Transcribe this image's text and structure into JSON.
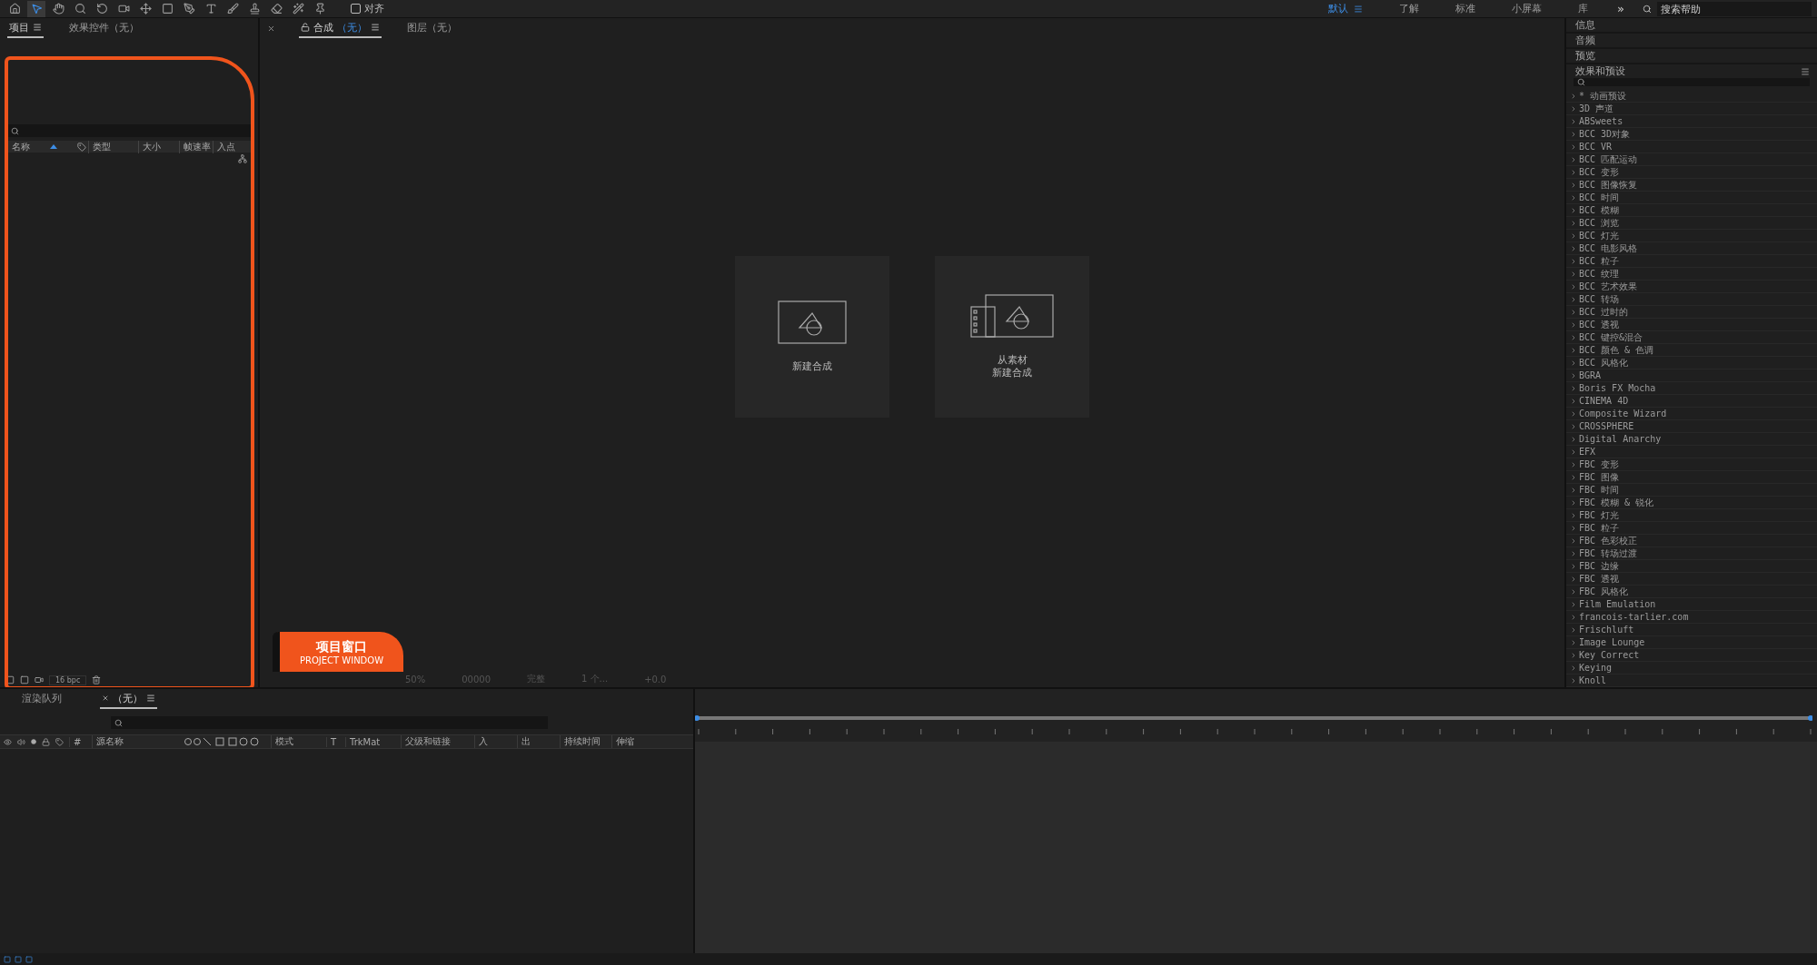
{
  "toolbar": {
    "tools": [
      {
        "kind": "home",
        "selected": false
      },
      {
        "kind": "select",
        "selected": true
      },
      {
        "kind": "hand",
        "selected": false
      },
      {
        "kind": "zoom",
        "selected": false
      },
      {
        "kind": "rotate",
        "selected": false
      },
      {
        "kind": "camera",
        "selected": false
      },
      {
        "kind": "anchor",
        "selected": false
      },
      {
        "kind": "rect",
        "selected": false
      },
      {
        "kind": "pen",
        "selected": false
      },
      {
        "kind": "type",
        "selected": false
      },
      {
        "kind": "brush",
        "selected": false
      },
      {
        "kind": "stamp",
        "selected": false
      },
      {
        "kind": "eraser",
        "selected": false
      },
      {
        "kind": "roto",
        "selected": false
      },
      {
        "kind": "pin",
        "selected": false
      }
    ],
    "snap": {
      "label": "对齐",
      "checked": false
    }
  },
  "workspaces": [
    {
      "label": "默认",
      "selected": true
    },
    {
      "label": "了解",
      "selected": false
    },
    {
      "label": "标准",
      "selected": false
    },
    {
      "label": "小屏幕",
      "selected": false
    },
    {
      "label": "库",
      "selected": false
    }
  ],
  "more": "»",
  "help_search": {
    "placeholder": "搜索帮助"
  },
  "project_panel": {
    "tabs": [
      {
        "label": "项目",
        "selected": true
      },
      {
        "label": "效果控件（无）",
        "selected": false
      }
    ],
    "columns": [
      "名称",
      "类型",
      "大小",
      "帧速率",
      "入点"
    ],
    "bit_depth": "16 bpc"
  },
  "viewer": {
    "tabs": [
      {
        "label": "合成",
        "target": "（无）",
        "selected": true
      },
      {
        "label": "图层（无）",
        "selected": false
      }
    ],
    "actions": [
      {
        "kind": "new",
        "lines": [
          "新建合成"
        ]
      },
      {
        "kind": "from_footage",
        "lines": [
          "从素材",
          "新建合成"
        ]
      }
    ],
    "footer": [
      "50%",
      "00000",
      "完整",
      "1 个...",
      "+0.0"
    ]
  },
  "callout": {
    "title": "项目窗口",
    "subtitle": "PROJECT WINDOW"
  },
  "side_panels": [
    "信息",
    "音频",
    "预览"
  ],
  "effects": {
    "title": "效果和预设",
    "items": [
      "* 动画预设",
      "3D 声道",
      "ABSweets",
      "BCC 3D对象",
      "BCC VR",
      "BCC 匹配运动",
      "BCC 变形",
      "BCC 图像恢复",
      "BCC 时间",
      "BCC 模糊",
      "BCC 浏览",
      "BCC 灯光",
      "BCC 电影风格",
      "BCC 粒子",
      "BCC 纹理",
      "BCC 艺术效果",
      "BCC 转场",
      "BCC 过时的",
      "BCC 透视",
      "BCC 键控&混合",
      "BCC 颜色 & 色调",
      "BCC 风格化",
      "BGRA",
      "Boris FX Mocha",
      "CINEMA 4D",
      "Composite Wizard",
      "CROSSPHERE",
      "Digital Anarchy",
      "EFX",
      "FBC 变形",
      "FBC 图像",
      "FBC 时间",
      "FBC 模糊 & 锐化",
      "FBC 灯光",
      "FBC 粒子",
      "FBC 色彩校正",
      "FBC 转场过渡",
      "FBC 边缘",
      "FBC 透视",
      "FBC 风格化",
      "Film Emulation",
      "francois-tarlier.com",
      "Frischluft",
      "Image Lounge",
      "Key Correct",
      "Keying",
      "Knoll"
    ]
  },
  "timeline": {
    "tabs": [
      {
        "label": "渲染队列",
        "selected": false
      },
      {
        "label": "（无）",
        "selected": true
      }
    ],
    "columns": [
      "#",
      "源名称",
      "模式",
      "T",
      "TrkMat",
      "父级和链接",
      "入",
      "出",
      "持续时间",
      "伸缩"
    ]
  }
}
